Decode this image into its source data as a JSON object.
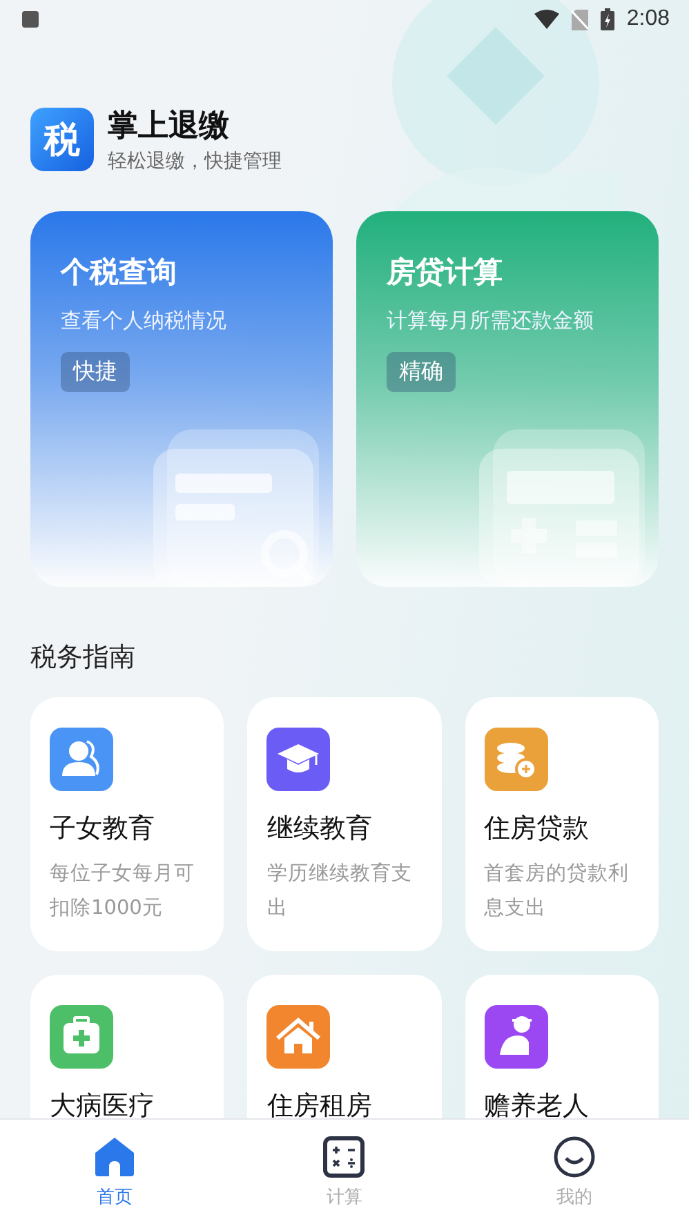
{
  "status_bar": {
    "time": "2:08"
  },
  "app": {
    "logo_text": "税",
    "title": "掌上退缴",
    "subtitle": "轻松退缴，快捷管理"
  },
  "feature_cards": [
    {
      "kind": "search",
      "title": "个税查询",
      "subtitle": "查看个人纳税情况",
      "tag": "快捷",
      "color": "#2a78ea"
    },
    {
      "kind": "calculator",
      "title": "房贷计算",
      "subtitle": "计算每月所需还款金额",
      "tag": "精确",
      "color": "#22b07d"
    }
  ],
  "guide": {
    "title": "税务指南",
    "items": [
      {
        "kind": "children",
        "title": "子女教育",
        "description": "每位子女每月可扣除1000元",
        "color": "#4a94f5"
      },
      {
        "kind": "graduation",
        "title": "继续教育",
        "description": "学历继续教育支出",
        "color": "#6c5cf6"
      },
      {
        "kind": "coins",
        "title": "住房贷款",
        "description": "首套房的贷款利息支出",
        "color": "#eba13a"
      },
      {
        "kind": "medical",
        "title": "大病医疗",
        "color": "#4cbf68"
      },
      {
        "kind": "house",
        "title": "住房租房",
        "color": "#f2862f"
      },
      {
        "kind": "elder",
        "title": "赡养老人",
        "color": "#9b48f2"
      }
    ]
  },
  "bottom_nav": [
    {
      "kind": "home",
      "label": "首页",
      "selected": true
    },
    {
      "kind": "calculator",
      "label": "计算",
      "selected": false
    },
    {
      "kind": "profile",
      "label": "我的",
      "selected": false
    }
  ]
}
